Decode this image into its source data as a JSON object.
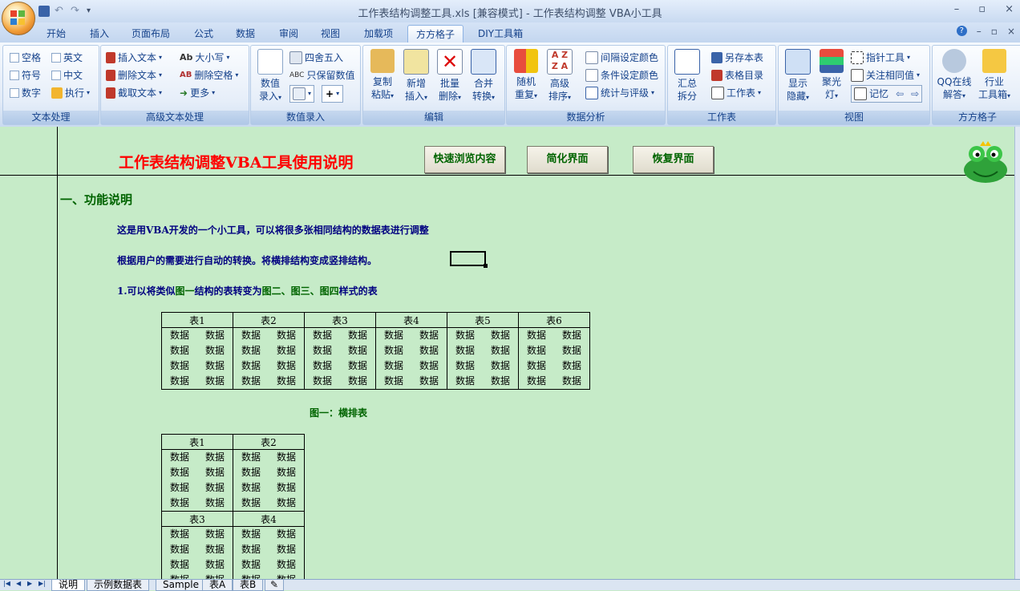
{
  "window": {
    "title": "工作表结构调整工具.xls  [兼容模式] - 工作表结构调整 VBA小工具",
    "controls": [
      "–",
      "▫",
      "×"
    ]
  },
  "tabs": [
    {
      "label": "开始"
    },
    {
      "label": "插入"
    },
    {
      "label": "页面布局"
    },
    {
      "label": "公式"
    },
    {
      "label": "数据"
    },
    {
      "label": "审阅"
    },
    {
      "label": "视图"
    },
    {
      "label": "加载项"
    },
    {
      "label": "方方格子",
      "active": true
    },
    {
      "label": "DIY工具箱"
    }
  ],
  "ribbon": {
    "text_proc": {
      "title": "文本处理",
      "items": [
        "空格",
        "英文",
        "符号",
        "中文",
        "数字",
        "执行"
      ]
    },
    "adv_text": {
      "title": "高级文本处理",
      "items": [
        "插入文本",
        "大小写",
        "删除文本",
        "删除空格",
        "截取文本",
        "更多"
      ]
    },
    "num_input": {
      "title": "数值录入",
      "big": "数值\n录入",
      "items": [
        "四舍五入",
        "只保留数值"
      ]
    },
    "edit": {
      "title": "编辑",
      "buttons": [
        "复制\n粘贴",
        "新增\n插入",
        "批量\n删除",
        "合并\n转换"
      ]
    },
    "analysis": {
      "title": "数据分析",
      "buttons": [
        "随机\n重复",
        "高级\n排序"
      ],
      "items": [
        "间隔设定颜色",
        "条件设定颜色",
        "统计与评级"
      ]
    },
    "sheet": {
      "title": "工作表",
      "big": "汇总\n拆分",
      "items": [
        "另存本表",
        "表格目录",
        "工作表"
      ]
    },
    "view": {
      "title": "视图",
      "buttons": [
        "显示\n隐藏",
        "聚光\n灯"
      ],
      "items": [
        "指针工具",
        "关注相同值",
        "记忆"
      ]
    },
    "ffgz": {
      "title": "方方格子",
      "buttons": [
        "QQ在线\n解答",
        "行业\n工具箱"
      ]
    }
  },
  "sheet": {
    "title": "工作表结构调整VBA工具使用说明",
    "buttons": [
      "快速浏览内容",
      "简化界面",
      "恢复界面"
    ],
    "section1": "一、功能说明",
    "para1": "这是用VBA开发的一个小工具，可以将很多张相同结构的数据表进行调整",
    "para2": "根据用户的需要进行自动的转换。将横排结构变成竖排结构。",
    "para3_a": "1.可以将类似",
    "para3_b": "图一",
    "para3_c": "结构的表转变为",
    "para3_d": "图二、图三、图四",
    "para3_e": "样式的表",
    "cell": "数据",
    "table1_headers": [
      "表1",
      "表2",
      "表3",
      "表4",
      "表5",
      "表6"
    ],
    "fig1_caption": "图一：横排表",
    "table2_headers_top": [
      "表1",
      "表2"
    ],
    "table2_headers_bottom": [
      "表3",
      "表4"
    ]
  },
  "sheet_tabs": [
    "说明",
    "示例数据表",
    "Sample",
    "表A",
    "表B"
  ]
}
